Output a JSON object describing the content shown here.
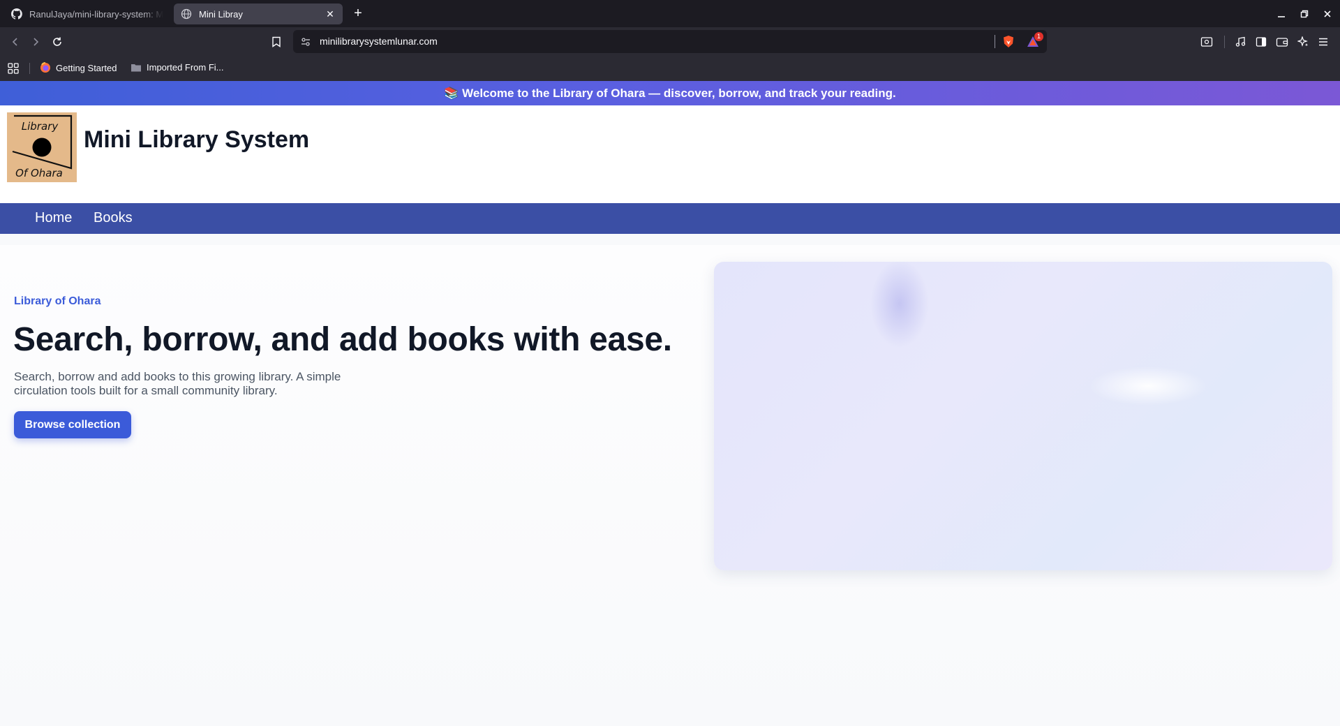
{
  "browser": {
    "tabs": [
      {
        "title": "RanulJaya/mini-library-system: M",
        "icon": "github-icon"
      },
      {
        "title": "Mini Libray",
        "icon": "globe-icon"
      }
    ],
    "url": "minilibrarysystemlunar.com",
    "bookmarks": [
      {
        "label": "Getting Started",
        "icon": "firefox-icon"
      },
      {
        "label": "Imported From Fi...",
        "icon": "folder-icon"
      }
    ],
    "shield_badge": "1"
  },
  "announcement": "📚 Welcome to the Library of Ohara — discover, borrow, and track your reading.",
  "header": {
    "logo_top": "Library",
    "logo_bottom": "Of Ohara",
    "title": "Mini Library System"
  },
  "nav": {
    "items": [
      {
        "label": "Home"
      },
      {
        "label": "Books"
      }
    ]
  },
  "hero": {
    "eyebrow": "Library of Ohara",
    "headline": "Search, borrow, and add books with ease.",
    "subtitle": "Search, borrow and add books to this growing library. A simple circulation tools built for a small community library.",
    "cta_label": "Browse collection"
  },
  "colors": {
    "accent": "#3b5bd9",
    "nav_bg": "#3b4fa5",
    "logo_bg": "#e4b98a",
    "chrome_bg": "#2b2a33"
  }
}
